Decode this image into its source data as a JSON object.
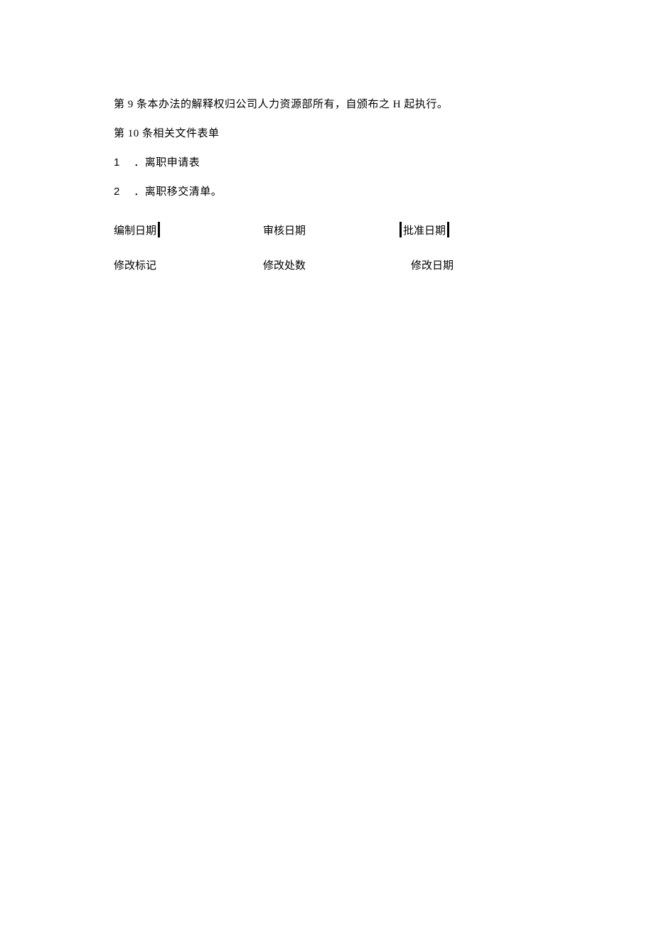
{
  "article9": "第 9 条本办法的解释权归公司人力资源部所有，自颁布之 H 起执行。",
  "article10": "第 10 条相关文件表单",
  "list": [
    {
      "num": "1",
      "text": "．离职申请表"
    },
    {
      "num": "2",
      "text": "．离职移交清单。"
    }
  ],
  "row1": {
    "col1": "编制日期",
    "col2": "审核日期",
    "col3": "批准日期"
  },
  "row2": {
    "col1": "修改标记",
    "col2": "修改处数",
    "col3": "修改日期"
  }
}
